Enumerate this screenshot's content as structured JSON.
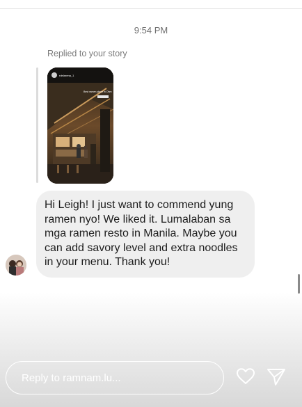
{
  "conversation": {
    "timestamp": "9:54 PM",
    "replied_label": "Replied to your story",
    "story": {
      "account": "rdelarena_1",
      "caption": "Best ramen place in Ohm"
    },
    "message": "Hi Leigh! I just want to commend yung ramen nyo! We liked it. Lumalaban sa mga ramen resto in Manila. Maybe you can add savory level and extra noodles in your menu. Thank you!"
  },
  "composer": {
    "placeholder": "Reply to ramnam.lu...",
    "icons": [
      "heart-icon",
      "send-icon"
    ],
    "text_color": "#ffffff"
  },
  "colors": {
    "bubble": "#efefef",
    "background": "#ffffff"
  }
}
